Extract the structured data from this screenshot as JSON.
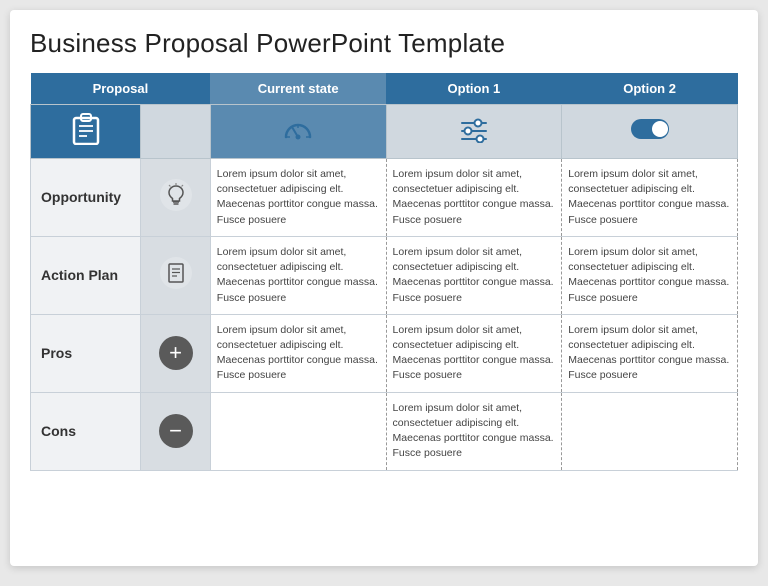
{
  "title": "Business Proposal PowerPoint Template",
  "table": {
    "headers": {
      "proposal": "Proposal",
      "current_state": "Current state",
      "option1": "Option 1",
      "option2": "Option 2"
    },
    "lorem": "Lorem ipsum dolor sit amet, consectetuer adipiscing elt. Maecenas porttitor congue massa. Fusce posuere",
    "rows": [
      {
        "label": "Opportunity",
        "icon": "💡",
        "icon_type": "light",
        "has_current": true,
        "has_opt1": true,
        "has_opt2": true
      },
      {
        "label": "Action Plan",
        "icon": "📋",
        "icon_type": "list",
        "has_current": true,
        "has_opt1": true,
        "has_opt2": true
      },
      {
        "label": "Pros",
        "icon": "+",
        "icon_type": "plus",
        "has_current": true,
        "has_opt1": true,
        "has_opt2": true
      },
      {
        "label": "Cons",
        "icon": "−",
        "icon_type": "minus",
        "has_current": false,
        "has_opt1": true,
        "has_opt2": false
      }
    ]
  }
}
